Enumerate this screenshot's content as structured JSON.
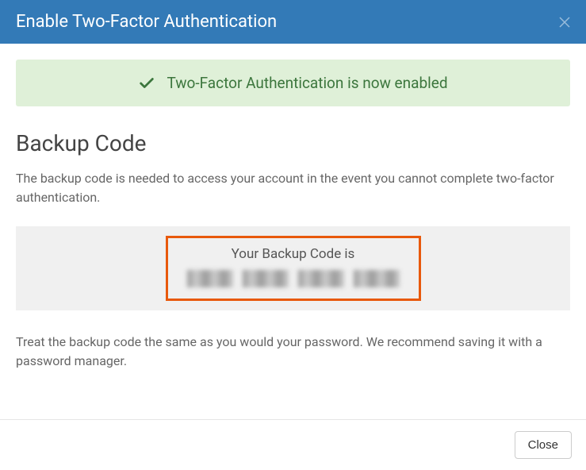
{
  "header": {
    "title": "Enable Two-Factor Authentication"
  },
  "alert": {
    "message": "Two-Factor Authentication is now enabled"
  },
  "section": {
    "title": "Backup Code",
    "description": "The backup code is needed to access your account in the event you cannot complete two-factor authentication.",
    "code_label": "Your Backup Code is",
    "footer_note": "Treat the backup code the same as you would your password. We recommend saving it with a password manager."
  },
  "footer": {
    "close_label": "Close"
  },
  "colors": {
    "header_bg": "#337ab7",
    "alert_bg": "#dff0d8",
    "alert_fg": "#3c763d",
    "highlight_border": "#e8590c"
  }
}
